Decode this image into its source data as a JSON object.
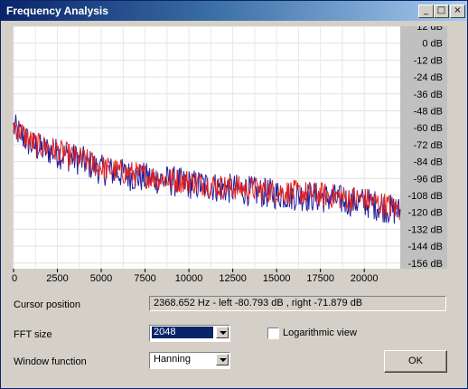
{
  "window": {
    "title": "Frequency Analysis"
  },
  "titlebar_buttons": {
    "minimize": "_",
    "maximize": "□",
    "close": "×"
  },
  "chart_data": {
    "type": "line",
    "x_ticks": [
      "0",
      "2500",
      "5000",
      "7500",
      "10000",
      "12500",
      "15000",
      "17500",
      "20000"
    ],
    "x_values": [
      0,
      2500,
      5000,
      7500,
      10000,
      12500,
      15000,
      17500,
      20000
    ],
    "xlim": [
      0,
      22050
    ],
    "y_ticks": [
      "12 dB",
      "0 dB",
      "-12 dB",
      "-24 dB",
      "-36 dB",
      "-48 dB",
      "-60 dB",
      "-72 dB",
      "-84 dB",
      "-96 dB",
      "-108 dB",
      "-120 dB",
      "-132 dB",
      "-144 dB",
      "-156 dB"
    ],
    "y_values": [
      12,
      0,
      -12,
      -24,
      -36,
      -48,
      -60,
      -72,
      -84,
      -96,
      -108,
      -120,
      -132,
      -144,
      -156
    ],
    "ylim": [
      -160,
      12
    ],
    "grid": true,
    "series": [
      {
        "color": "#2020a0",
        "x": [
          0,
          500,
          1000,
          1500,
          2000,
          3000,
          4000,
          5000,
          6000,
          7000,
          8000,
          9000,
          10000,
          11000,
          12000,
          13000,
          14000,
          15000,
          16000,
          17000,
          18000,
          19000,
          20000,
          21000,
          22050
        ],
        "y": [
          -60,
          -66,
          -72,
          -75,
          -76,
          -80,
          -84,
          -90,
          -92,
          -95,
          -96,
          -98,
          -100,
          -101,
          -103,
          -104,
          -106,
          -107,
          -108,
          -109,
          -110,
          -112,
          -113,
          -116,
          -120
        ]
      },
      {
        "color": "#e02020",
        "x": [
          0,
          500,
          1000,
          1500,
          2000,
          3000,
          4000,
          5000,
          6000,
          7000,
          8000,
          9000,
          10000,
          11000,
          12000,
          13000,
          14000,
          15000,
          16000,
          17000,
          18000,
          19000,
          20000,
          21000,
          22050
        ],
        "y": [
          -58,
          -64,
          -70,
          -73,
          -74,
          -79,
          -83,
          -88,
          -91,
          -93,
          -95,
          -97,
          -98,
          -100,
          -102,
          -103,
          -104,
          -105,
          -106,
          -107,
          -108,
          -110,
          -111,
          -114,
          -118
        ]
      }
    ]
  },
  "controls": {
    "cursor_label": "Cursor position",
    "cursor_value": "2368.652 Hz  -  left -80.793 dB , right -71.879 dB",
    "fft_label": "FFT size",
    "fft_value": "2048",
    "log_label": "Logarithmic view",
    "log_checked": false,
    "window_label": "Window function",
    "window_value": "Hanning",
    "ok_label": "OK"
  }
}
